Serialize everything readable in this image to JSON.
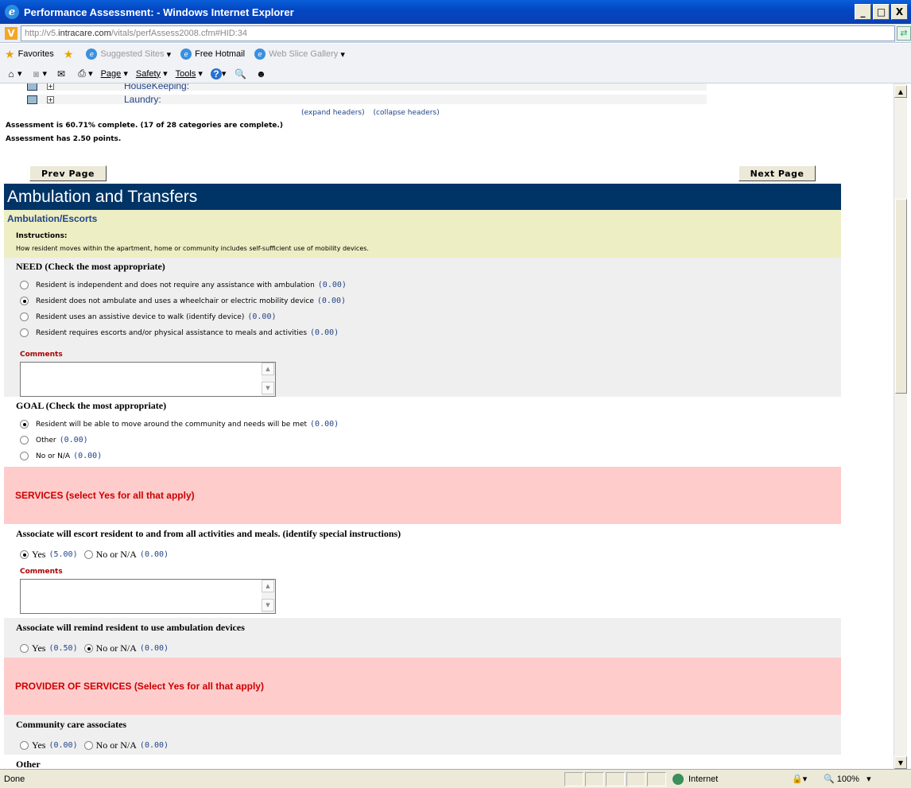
{
  "window": {
    "title": "Performance Assessment: - Windows Internet Explorer",
    "buttons": [
      "_",
      "□",
      "X"
    ]
  },
  "address": {
    "prefix": "http://v5.",
    "domain": "intracare.com",
    "path": "/vitals/perfAssess2008.cfm#HID:34"
  },
  "favorites_bar": {
    "favorites": "Favorites",
    "suggested": "Suggested Sites",
    "hotmail": "Free Hotmail",
    "webslice": "Web Slice Gallery"
  },
  "command_bar": {
    "page": "Page",
    "safety": "Safety",
    "tools": "Tools"
  },
  "tree": {
    "items": [
      {
        "label": "HouseKeeping:"
      },
      {
        "label": "Laundry:"
      }
    ],
    "expand": "(expand headers)",
    "collapse": "(collapse headers)"
  },
  "summary": {
    "line1": "Assessment is 60.71% complete. (17 of 28 categories are complete.)",
    "line2": "Assessment has 2.50 points."
  },
  "nav": {
    "prev": "Prev Page",
    "next": "Next Page"
  },
  "section": {
    "title": "Ambulation and Transfers",
    "subtitle": "Ambulation/Escorts"
  },
  "instructions": {
    "label": "Instructions:",
    "text": "How resident moves within the apartment, home or community includes self-sufficient use of mobility devices."
  },
  "need": {
    "question": "NEED (Check the most appropriate)",
    "options": [
      {
        "label": "Resident is independent and does not require any assistance with ambulation",
        "points": "(0.00)",
        "checked": false
      },
      {
        "label": "Resident does not ambulate and uses a wheelchair or electric mobility device",
        "points": "(0.00)",
        "checked": true
      },
      {
        "label": "Resident uses an assistive device to walk (identify device)",
        "points": "(0.00)",
        "checked": false
      },
      {
        "label": "Resident requires escorts and/or physical assistance to meals and activities",
        "points": "(0.00)",
        "checked": false
      }
    ],
    "comments_label": "Comments"
  },
  "goal": {
    "question": "GOAL (Check the most appropriate)",
    "options": [
      {
        "label": "Resident will be able to move around the community and needs will be met",
        "points": "(0.00)",
        "checked": true
      },
      {
        "label": "Other",
        "points": "(0.00)",
        "checked": false
      },
      {
        "label": "No or N/A",
        "points": "(0.00)",
        "checked": false
      }
    ]
  },
  "services": {
    "header": "SERVICES (select Yes for all that apply)",
    "items": [
      {
        "question": "Associate will escort resident to and from all activities and meals. (identify special instructions)",
        "yes": "Yes",
        "yes_points": "(5.00)",
        "no": "No or N/A",
        "no_points": "(0.00)",
        "selected": "yes",
        "comments_label": "Comments"
      },
      {
        "question": "Associate will remind resident to use ambulation devices",
        "yes": "Yes",
        "yes_points": "(0.50)",
        "no": "No or N/A",
        "no_points": "(0.00)",
        "selected": "no"
      }
    ]
  },
  "provider": {
    "header": "PROVIDER OF SERVICES (Select Yes for all that apply)",
    "items": [
      {
        "question": "Community care associates",
        "yes": "Yes",
        "yes_points": "(0.00)",
        "no": "No or N/A",
        "no_points": "(0.00)",
        "selected": "none"
      },
      {
        "question": "Other"
      }
    ]
  },
  "status": {
    "text": "Done",
    "zone": "Internet",
    "zoom": "100%"
  }
}
